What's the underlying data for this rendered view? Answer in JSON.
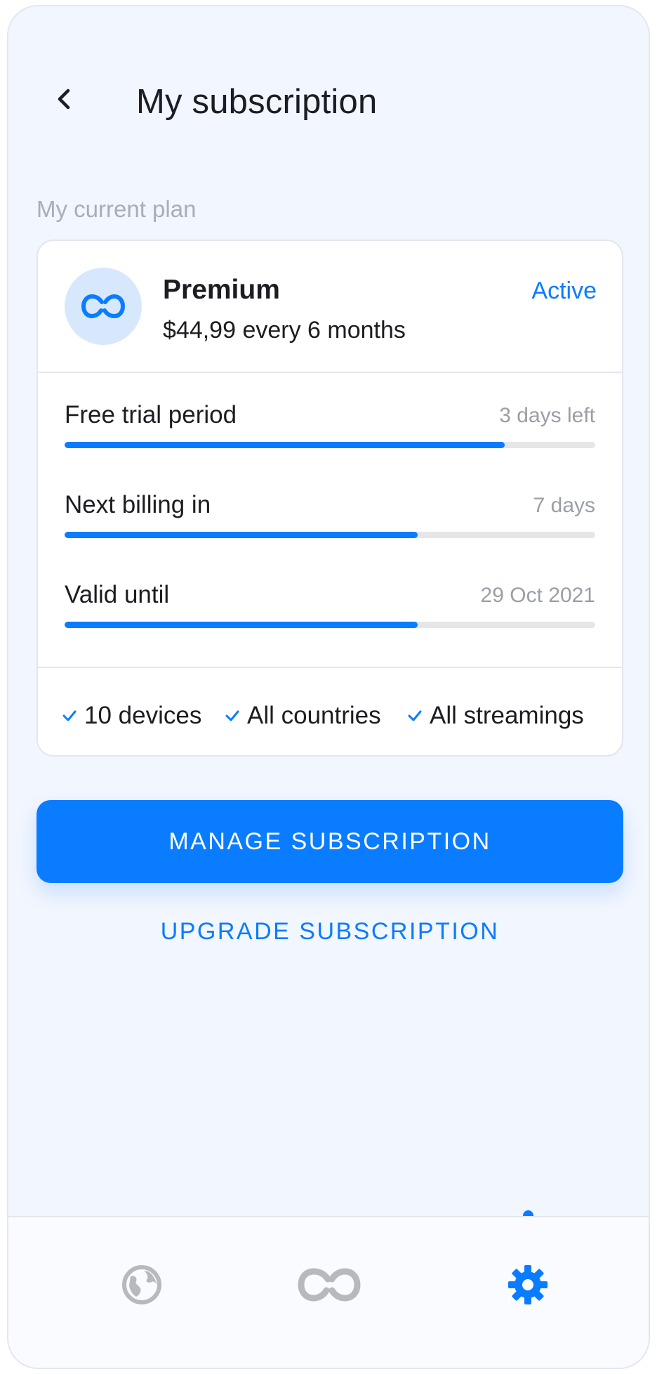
{
  "header": {
    "title": "My subscription",
    "back_icon": "chevron-left-icon"
  },
  "section_label": "My current plan",
  "plan": {
    "name": "Premium",
    "price": "$44,99 every 6 months",
    "status": "Active",
    "icon": "infinity-icon"
  },
  "progress_rows": [
    {
      "label": "Free trial period",
      "value": "3 days left",
      "progress": 0.83
    },
    {
      "label": "Next billing in",
      "value": "7 days",
      "progress": 0.665
    },
    {
      "label": "Valid until",
      "value": "29 Oct 2021",
      "progress": 0.665
    }
  ],
  "features": [
    {
      "label": "10 devices"
    },
    {
      "label": "All countries"
    },
    {
      "label": "All streamings"
    }
  ],
  "buttons": {
    "manage": "MANAGE SUBSCRIPTION",
    "upgrade": "UPGRADE SUBSCRIPTION"
  },
  "tabbar": {
    "items": [
      {
        "icon": "globe-icon",
        "active": false
      },
      {
        "icon": "infinity-icon",
        "active": false
      },
      {
        "icon": "gear-icon",
        "active": true
      }
    ]
  },
  "colors": {
    "accent": "#0A7CFF",
    "background": "#F2F6FE",
    "text": "#1C1D22",
    "muted": "#9A9EA6",
    "inactive_icon": "#B7B9BE"
  }
}
